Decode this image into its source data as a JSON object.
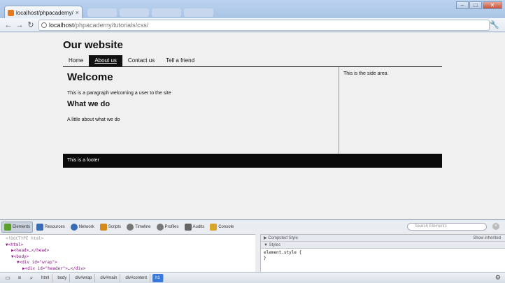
{
  "browser": {
    "tab_title": "localhost/phpacademy/tuto",
    "tab_close": "×",
    "url_host": "localhost",
    "url_path": "/phpacademy/tutorials/css/",
    "back": "←",
    "forward": "→",
    "reload": "↻",
    "wrench": "🔧",
    "min": "–",
    "max": "□",
    "close": "✕"
  },
  "site": {
    "title": "Our website",
    "nav": [
      "Home",
      "About us",
      "Contact us",
      "Tell a friend"
    ],
    "active_nav": "About us",
    "heading": "Welcome",
    "paragraph": "This is a paragraph welcoming a user to the site",
    "subheading": "What we do",
    "subparagraph": "A little about what we do",
    "side_text": "This is the side area",
    "footer": "This is a footer"
  },
  "devtools": {
    "tabs": [
      {
        "label": "Elements",
        "color": "#5aa02c"
      },
      {
        "label": "Resources",
        "color": "#3a6db5"
      },
      {
        "label": "Network",
        "color": "#3a6db5"
      },
      {
        "label": "Scripts",
        "color": "#d78a1c"
      },
      {
        "label": "Timeline",
        "color": "#777777"
      },
      {
        "label": "Profiles",
        "color": "#777777"
      },
      {
        "label": "Audits",
        "color": "#666666"
      },
      {
        "label": "Console",
        "color": "#d6a52a"
      }
    ],
    "search_placeholder": "Search Elements",
    "dom_lines": [
      "<!DOCTYPE html>",
      "▼<html>",
      "  ▶<head>…</head>",
      "  ▼<body>",
      "    ▼<div id=\"wrap\">",
      "      ▶<div id=\"header\">…</div>"
    ],
    "computed_style": "Computed Style",
    "show_inherited": "Show inherited",
    "styles": "Styles",
    "style_rule": "element.style {",
    "style_close": "}",
    "breadcrumbs": [
      "html",
      "body",
      "div#wrap",
      "div#main",
      "div#content",
      "h1"
    ],
    "active_crumb": "h1"
  }
}
